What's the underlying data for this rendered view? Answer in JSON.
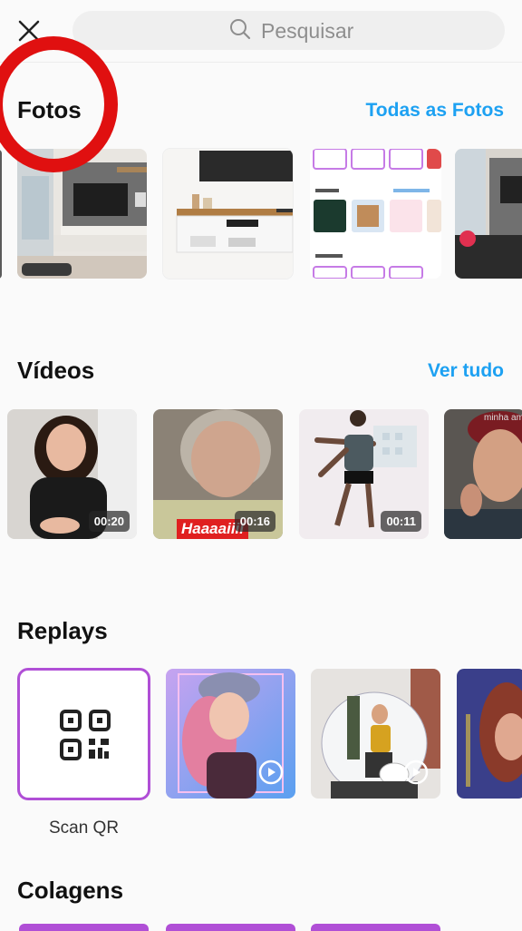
{
  "search": {
    "placeholder": "Pesquisar"
  },
  "photos": {
    "title": "Fotos",
    "link": "Todas as Fotos"
  },
  "videos": {
    "title": "Vídeos",
    "link": "Ver tudo",
    "items": [
      {
        "duration": "00:20"
      },
      {
        "duration": "00:16",
        "caption": "Haaaaiiii"
      },
      {
        "duration": "00:11"
      },
      {
        "caption": "minha am"
      }
    ]
  },
  "replays": {
    "title": "Replays",
    "scan_label": "Scan QR"
  },
  "collages": {
    "title": "Colagens"
  },
  "colors": {
    "link": "#1da1f2",
    "annotation_ring": "#e01010",
    "accent_border": "#b04fd6"
  }
}
